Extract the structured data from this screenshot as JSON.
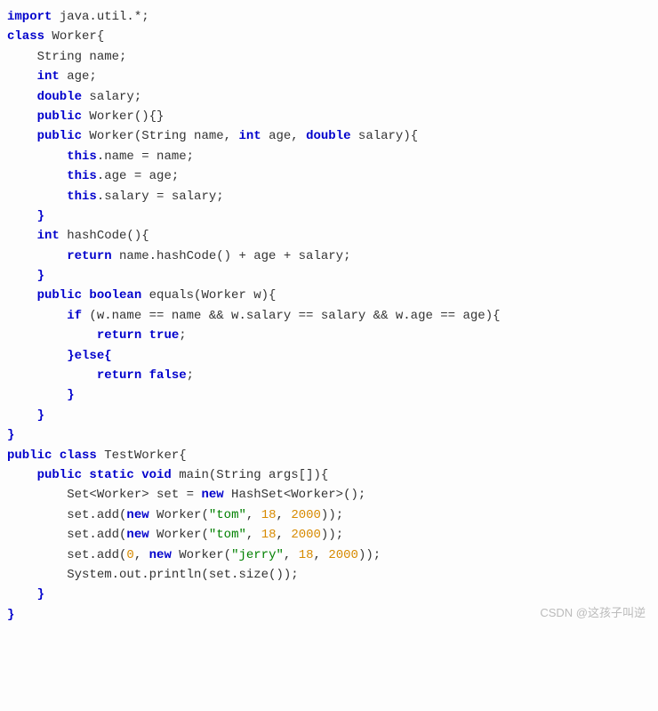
{
  "code": {
    "line1_import": "import",
    "line1_rest": " java.util.*;",
    "line2_class": "class",
    "line2_name": " Worker{",
    "line3_field": "    String name;",
    "line4_int": "    int",
    "line4_rest": " age;",
    "line5_double": "    double",
    "line5_rest": " salary;",
    "line6_public": "    public",
    "line6_rest": " Worker(){}",
    "line7_public": "    public",
    "line7_mid": " Worker(String name, ",
    "line7_int": "int",
    "line7_mid2": " age, ",
    "line7_double": "double",
    "line7_rest": " salary){",
    "line8_this": "        this",
    "line8_rest": ".name = name;",
    "line9_this": "        this",
    "line9_rest": ".age = age;",
    "line10_this": "        this",
    "line10_rest": ".salary = salary;",
    "line11": "    }",
    "line12_int": "    int",
    "line12_rest": " hashCode(){",
    "line13_return": "        return",
    "line13_rest": " name.hashCode() + age + salary;",
    "line14": "    }",
    "line15_public": "    public",
    "line15_bool": " boolean",
    "line15_rest": " equals(Worker w){",
    "line16_if": "        if",
    "line16_rest": " (w.name == name && w.salary == salary && w.age == age){",
    "line17_return": "            return",
    "line17_true": " true",
    "line17_semi": ";",
    "line18_else": "        }else{",
    "line19_return": "            return",
    "line19_false": " false",
    "line19_semi": ";",
    "line20": "        }",
    "line21": "    }",
    "line22": "}",
    "line23_public": "public",
    "line23_class": " class",
    "line23_rest": " TestWorker{",
    "line24_public": "    public",
    "line24_static": " static",
    "line24_void": " void",
    "line24_rest": " main(String args[]){",
    "line25_a": "        Set<Worker> set = ",
    "line25_new": "new",
    "line25_b": " HashSet<Worker>();",
    "line26_a": "        set.add(",
    "line26_new": "new",
    "line26_b": " Worker(",
    "line26_str": "\"tom\"",
    "line26_c": ", ",
    "line26_n1": "18",
    "line26_d": ", ",
    "line26_n2": "2000",
    "line26_e": "));",
    "line27_a": "        set.add(",
    "line27_new": "new",
    "line27_b": " Worker(",
    "line27_str": "\"tom\"",
    "line27_c": ", ",
    "line27_n1": "18",
    "line27_d": ", ",
    "line27_n2": "2000",
    "line27_e": "));",
    "line28_a": "        set.add(",
    "line28_n0": "0",
    "line28_aa": ", ",
    "line28_new": "new",
    "line28_b": " Worker(",
    "line28_str": "\"jerry\"",
    "line28_c": ", ",
    "line28_n1": "18",
    "line28_d": ", ",
    "line28_n2": "2000",
    "line28_e": "));",
    "line29": "        System.out.println(set.size());",
    "line30": "    }",
    "line31": "}"
  },
  "watermark": "CSDN @这孩子叫逆"
}
